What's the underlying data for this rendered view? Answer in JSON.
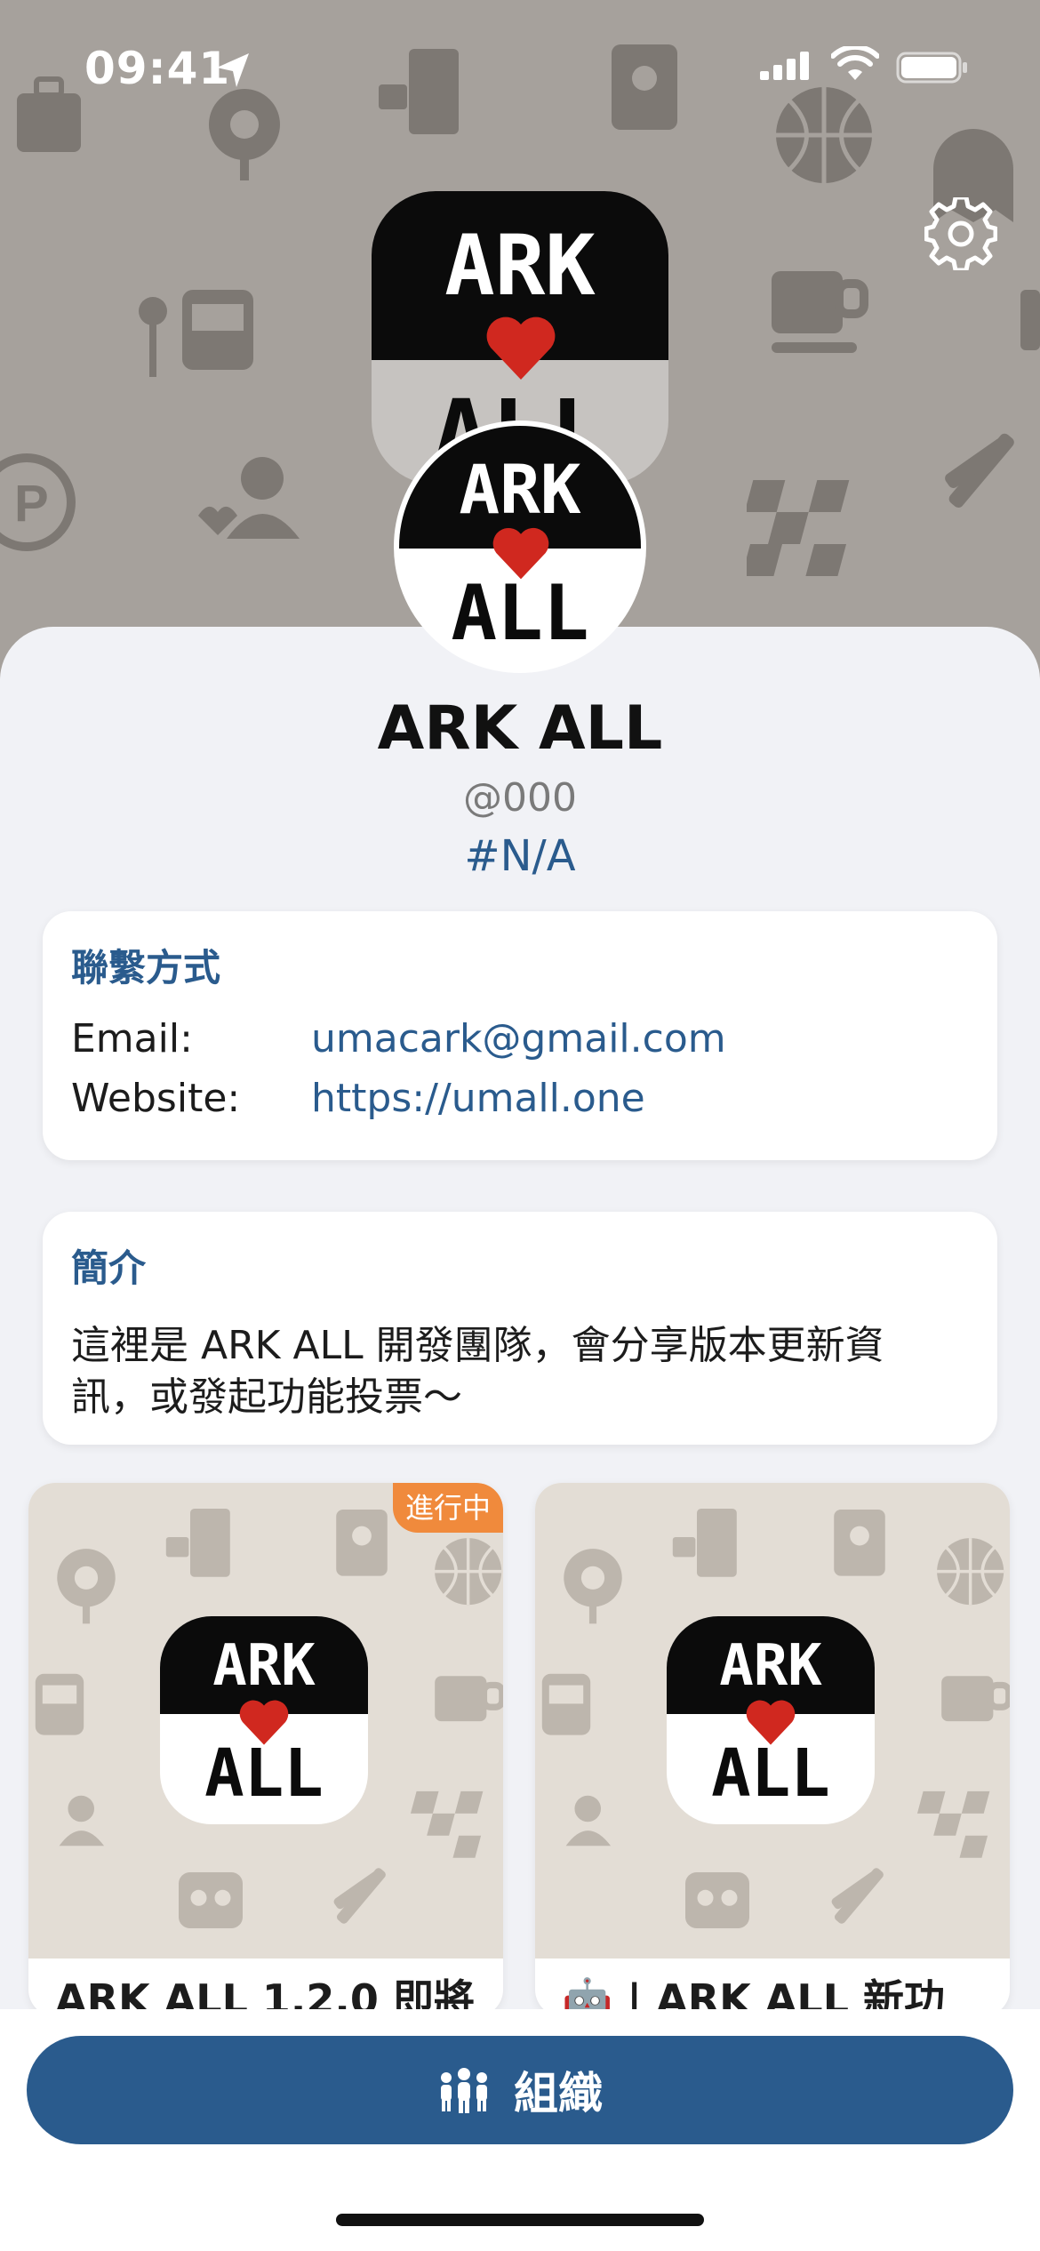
{
  "status_bar": {
    "time": "09:41"
  },
  "profile": {
    "name": "ARK ALL",
    "handle": "@000",
    "tag": "#N/A",
    "logo_text_top": "ARK",
    "logo_text_bottom": "ALL"
  },
  "contact": {
    "title": "聯繫方式",
    "email_label": "Email:",
    "email_value": "umacark@gmail.com",
    "website_label": "Website:",
    "website_value": "https://umall.one"
  },
  "bio": {
    "title": "簡介",
    "text": "這裡是 ARK ALL 開發團隊，會分享版本更新資訊，或發起功能投票～"
  },
  "posts": [
    {
      "badge": "進行中",
      "title": "ARK ALL 1.2.0 即將"
    },
    {
      "badge": "",
      "title": "🤖 | ARK ALL 新功"
    }
  ],
  "bottom": {
    "org_button_label": "組織"
  },
  "colors": {
    "accent": "#2a5b8d",
    "badge": "#f08a3c",
    "header_bg": "#a6a19c"
  }
}
